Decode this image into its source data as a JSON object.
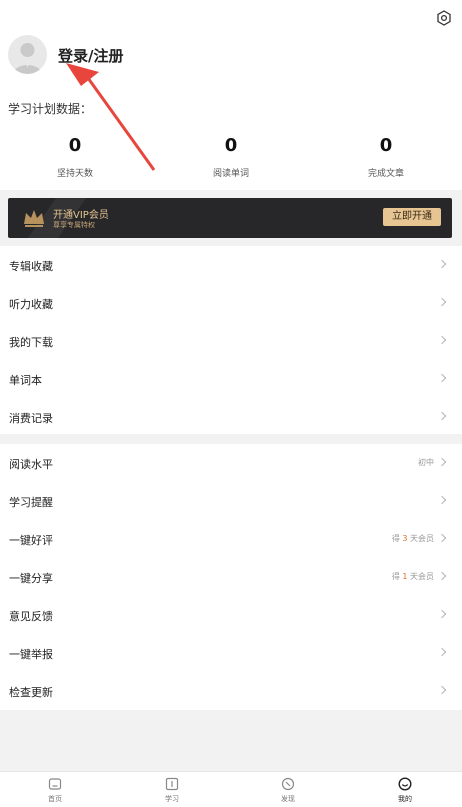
{
  "header": {
    "login_label": "登录/注册",
    "settings_icon": "settings-icon",
    "avatar_icon": "user-avatar-icon"
  },
  "plan": {
    "title": "学习计划数据：",
    "stats": [
      {
        "value": "0",
        "label": "坚持天数"
      },
      {
        "value": "0",
        "label": "阅读单词"
      },
      {
        "value": "0",
        "label": "完成文章"
      }
    ]
  },
  "vip": {
    "title": "开通VIP会员",
    "subtitle": "尊享专属特权",
    "button": "立即开通",
    "accent": "#e6c592"
  },
  "menu_group_1": [
    {
      "label": "专辑收藏"
    },
    {
      "label": "听力收藏"
    },
    {
      "label": "我的下载"
    },
    {
      "label": "单词本"
    },
    {
      "label": "消费记录"
    }
  ],
  "menu_group_2": [
    {
      "label": "阅读水平",
      "right": "初中"
    },
    {
      "label": "学习提醒"
    },
    {
      "label": "一键好评",
      "right_prefix": "得 ",
      "right_num": "3",
      "right_suffix": " 天会员"
    },
    {
      "label": "一键分享",
      "right_prefix": "得 ",
      "right_num": "1",
      "right_suffix": " 天会员"
    },
    {
      "label": "意见反馈"
    },
    {
      "label": "一键举报"
    },
    {
      "label": "检查更新"
    }
  ],
  "tabs": [
    {
      "label": "首页",
      "icon": "home-icon"
    },
    {
      "label": "学习",
      "icon": "book-icon"
    },
    {
      "label": "发现",
      "icon": "compass-icon"
    },
    {
      "label": "我的",
      "icon": "smile-icon"
    }
  ],
  "annotation_color": "#e8463c"
}
